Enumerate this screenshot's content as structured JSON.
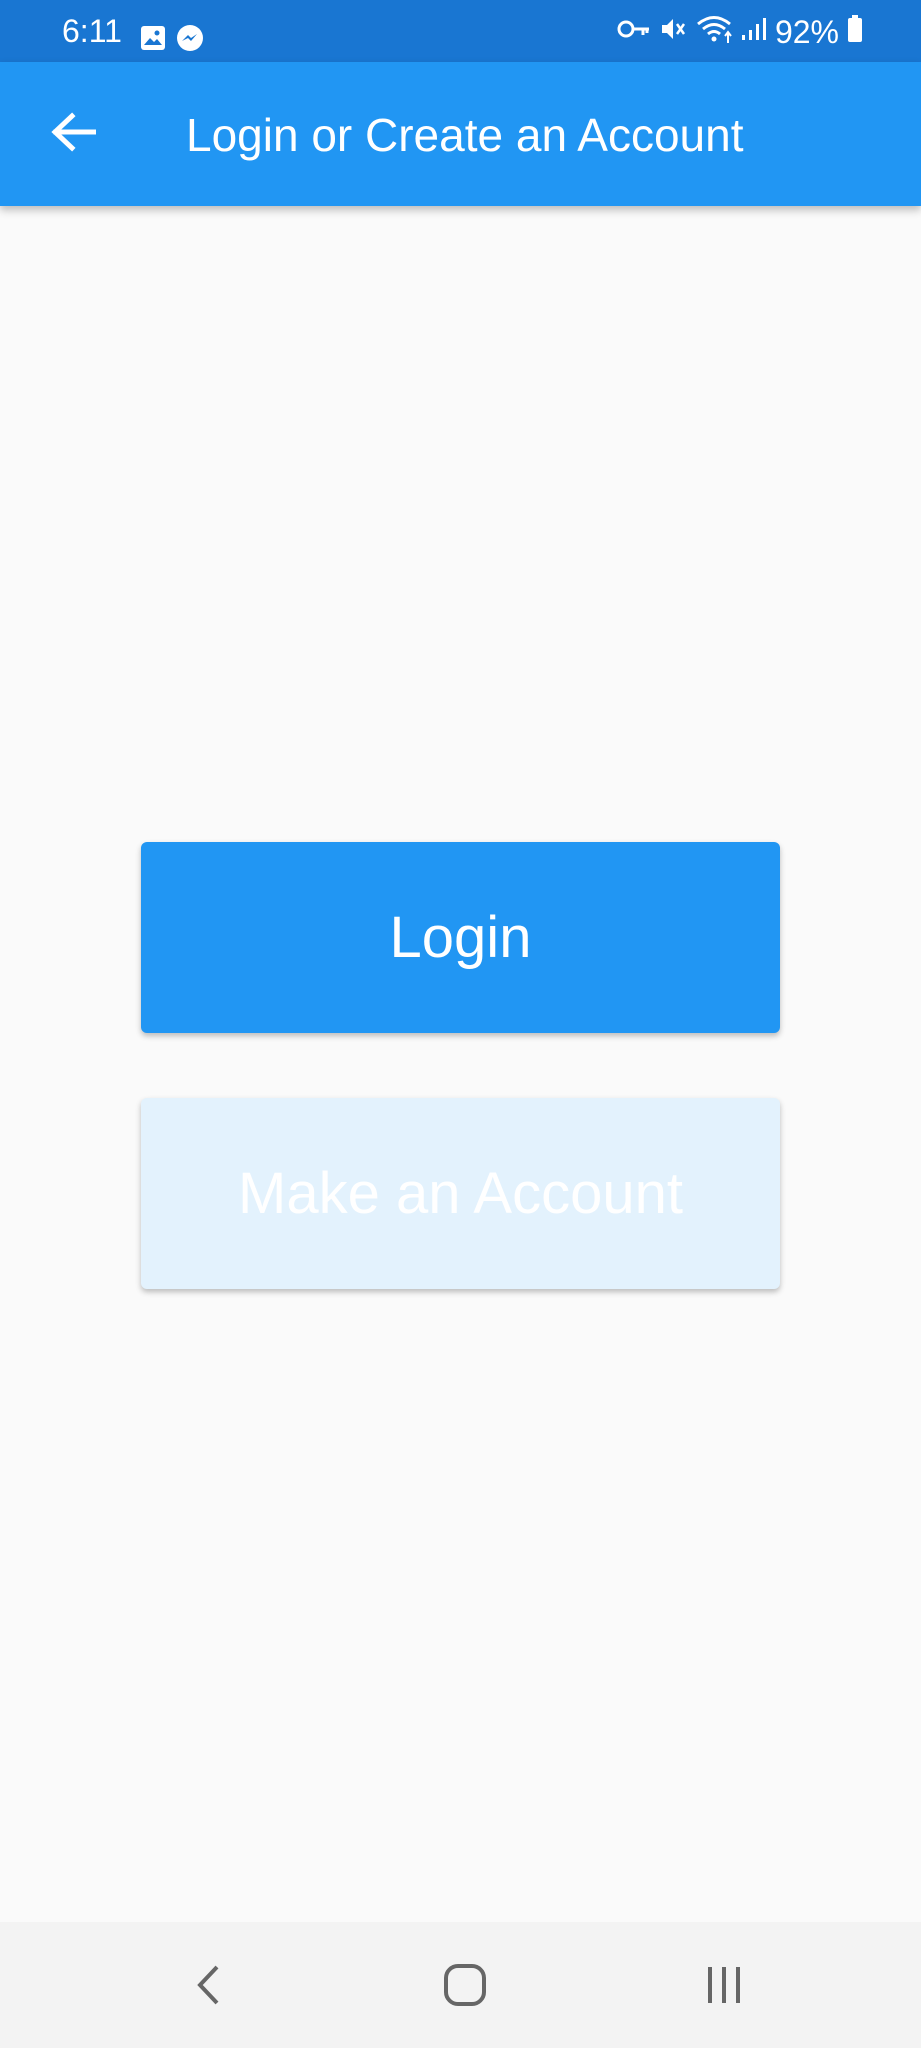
{
  "status_bar": {
    "time": "6:11",
    "battery": "92%",
    "left_icons": [
      "gallery-icon",
      "messenger-icon"
    ],
    "right_icons": [
      "vpn-key-icon",
      "mute-icon",
      "wifi-icon",
      "signal-icon",
      "battery-icon"
    ]
  },
  "app_bar": {
    "title": "Login or Create an Account",
    "back_icon": "arrow-left-icon"
  },
  "actions": {
    "login_label": "Login",
    "signup_label": "Make an Account"
  },
  "nav_bar": {
    "icons": [
      "back-icon",
      "home-icon",
      "recents-icon"
    ]
  },
  "colors": {
    "status_bar": "#1976d2",
    "app_bar": "#2196f3",
    "primary_button": "#2196f3",
    "secondary_button": "#e3f2fd",
    "background": "#fafafa"
  }
}
